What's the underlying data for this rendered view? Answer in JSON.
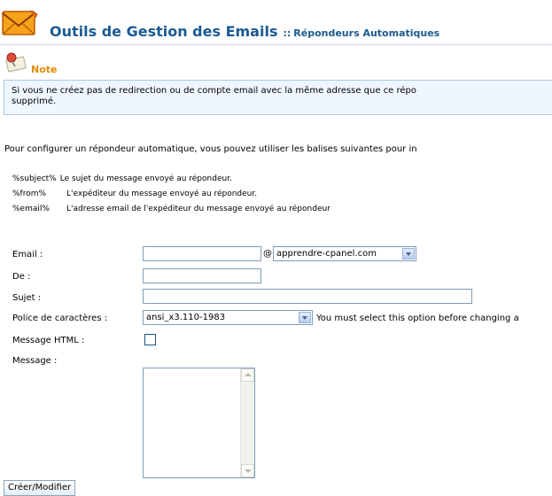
{
  "header": {
    "title": "Outils de Gestion des Emails",
    "separator": "::",
    "subtitle": "Répondeurs Automatiques",
    "icon": "envelope-icon"
  },
  "note": {
    "icon": "note-pin-icon",
    "label": "Note",
    "text": "Si vous ne créez pas de redirection ou de compte email avec la même adresse que ce répondeur automatique, le répondeur ne fonctionnera pas. Si vous supprimez le compte email ou la redirection, le répondeur sera supprimé.",
    "text_line1": "Si vous ne créez pas de redirection ou de compte email avec la même adresse que ce répo",
    "text_line2": "supprimé."
  },
  "intro": "Pour configurer un répondeur automatique, vous pouvez utiliser les balises suivantes pour in",
  "tags": [
    {
      "key": "%subject%",
      "desc": "Le sujet du message envoyé au répondeur."
    },
    {
      "key": "%from%",
      "desc": "L'expéditeur du message envoyé au répondeur."
    },
    {
      "key": "%email%",
      "desc": "L'adresse email de l'expéditeur du message envoyé au répondeur"
    }
  ],
  "form": {
    "email_label": "Email :",
    "email_value": "",
    "at_sign": "@",
    "domain_selected": "apprendre-cpanel.com",
    "from_label": "De :",
    "from_value": "",
    "subject_label": "Sujet :",
    "subject_value": "",
    "charset_label": "Police de caractères :",
    "charset_selected": "ansi_x3.110-1983",
    "charset_note": "You must select this option before changing a",
    "html_label": "Message HTML :",
    "html_checked": false,
    "message_label": "Message :",
    "message_value": "",
    "submit_label": "Créer/Modifier"
  }
}
